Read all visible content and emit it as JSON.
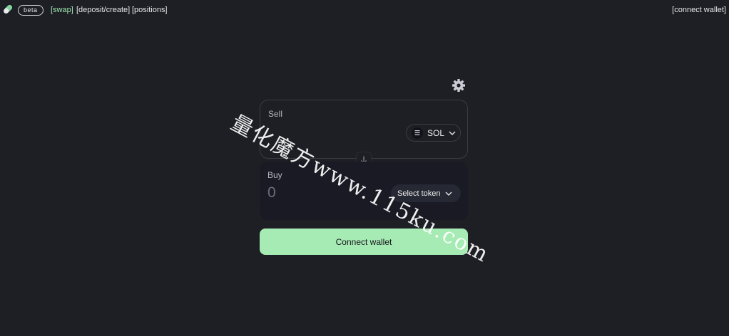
{
  "header": {
    "badge": "beta",
    "nav": [
      {
        "label": "[swap]",
        "active": true
      },
      {
        "label": "[deposit/create]"
      },
      {
        "label": "[positions]"
      }
    ],
    "connect_label": "[connect wallet]"
  },
  "swap": {
    "sell": {
      "label": "Sell",
      "token": "SOL"
    },
    "buy": {
      "label": "Buy",
      "amount": "0",
      "token_placeholder": "Select token"
    },
    "connect_button": "Connect wallet"
  },
  "watermark": "量化魔方www.115ku.com",
  "colors": {
    "background": "#1e1f25",
    "accent": "#a6eab4",
    "active_nav": "#9fe8b0"
  },
  "icons": [
    "pill-logo-icon",
    "gear-icon",
    "solana-icon",
    "chevron-down-icon",
    "arrow-down-icon"
  ]
}
